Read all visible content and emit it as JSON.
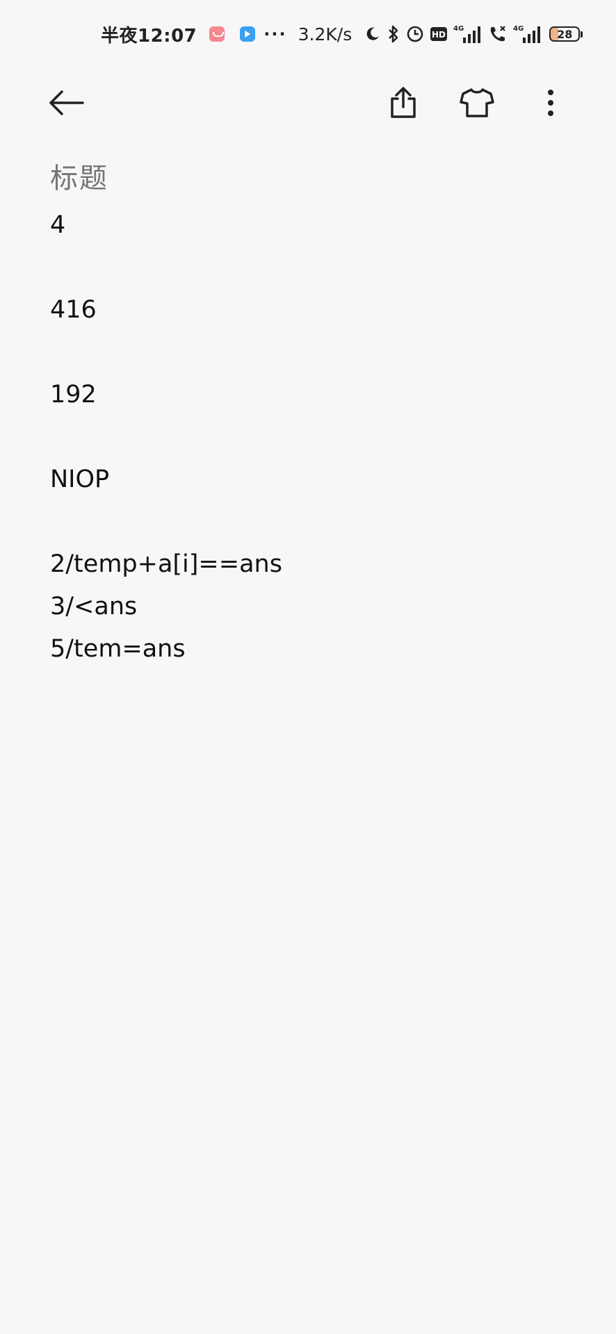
{
  "status_bar": {
    "time": "半夜12:07",
    "overflow": "···",
    "net_speed": "3.2K/s",
    "hd": "HD",
    "sim1_type": "4G",
    "sim2_type": "4G",
    "battery_level": "28",
    "battery_fraction": 0.28,
    "icons": [
      "app-pink-icon",
      "app-blue-icon",
      "moon-icon",
      "bluetooth-icon",
      "alarm-icon",
      "hd-icon",
      "signal-icon",
      "call-icon",
      "signal-icon",
      "battery-icon"
    ]
  },
  "toolbar": {
    "back_icon": "arrow-left-icon",
    "share_icon": "share-icon",
    "theme_icon": "tshirt-icon",
    "more_icon": "more-vertical-icon"
  },
  "note": {
    "title_placeholder": "标题",
    "lines": [
      "4",
      "",
      "416",
      "",
      "192",
      "",
      "NIOP",
      "",
      "2/temp+a[i]==ans",
      "3/<ans",
      "5/tem=ans"
    ]
  },
  "colors": {
    "background": "#f7f7f7",
    "text": "#111111",
    "placeholder": "#bdbdbd",
    "battery_fill": "#f0b487"
  }
}
